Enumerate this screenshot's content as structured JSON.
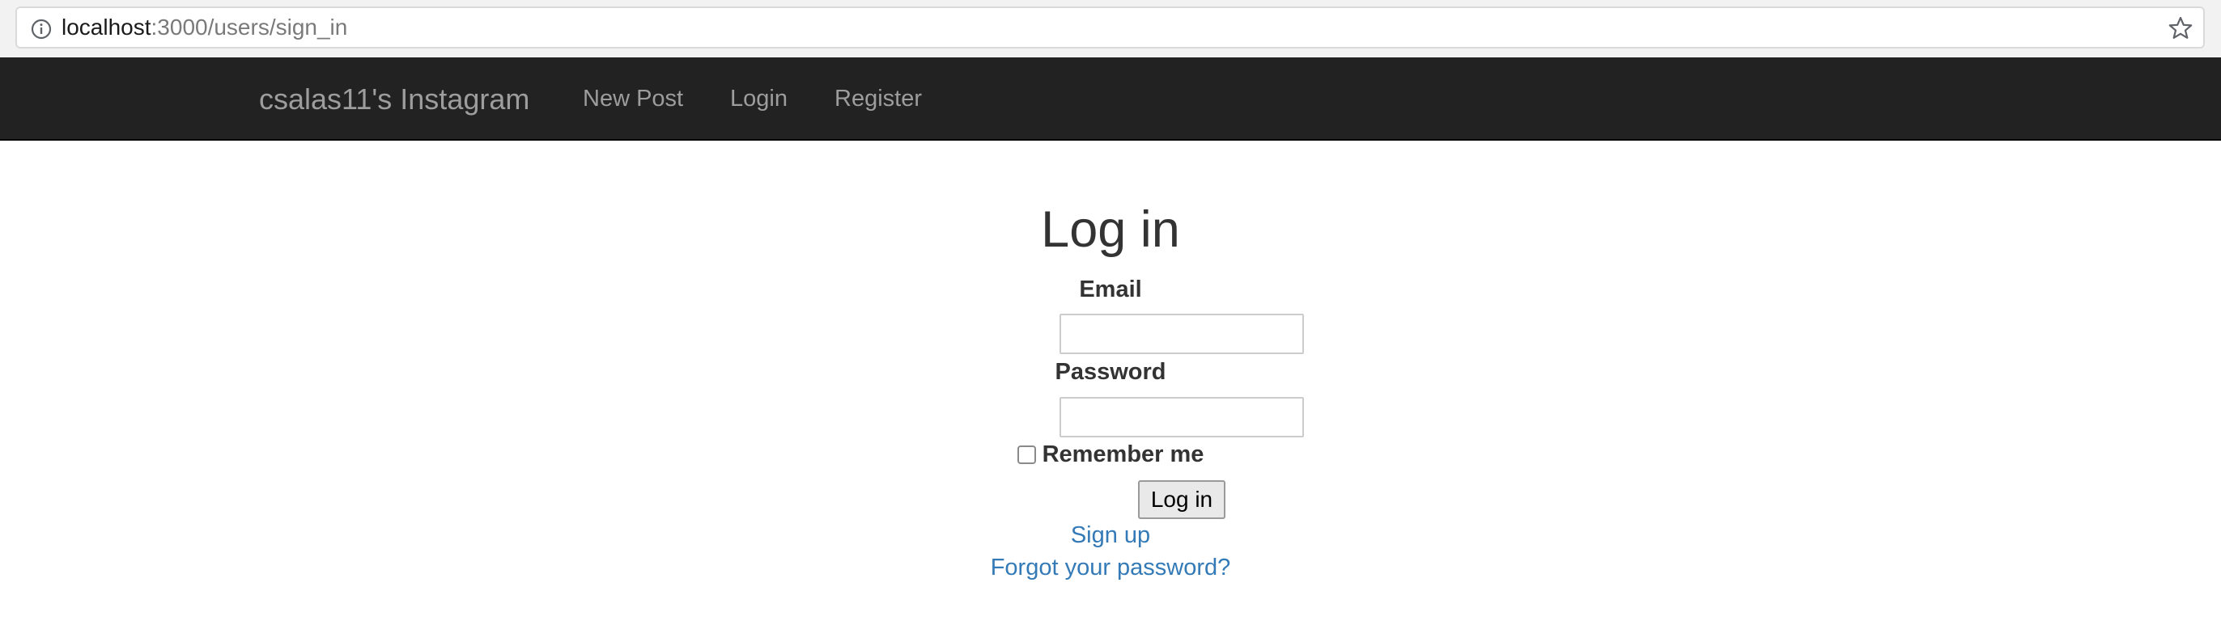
{
  "browser": {
    "url_host": "localhost",
    "url_path": ":3000/users/sign_in",
    "icons": {
      "info": "info-icon",
      "bookmark": "star-icon"
    }
  },
  "navbar": {
    "brand": "csalas11's Instagram",
    "links": [
      "New Post",
      "Login",
      "Register"
    ]
  },
  "form": {
    "title": "Log in",
    "email_label": "Email",
    "email_value": "",
    "password_label": "Password",
    "password_value": "",
    "remember_label": "Remember me",
    "remember_checked": false,
    "submit_label": "Log in",
    "signup_link": "Sign up",
    "forgot_link": "Forgot your password?"
  },
  "colors": {
    "navbar_bg": "#222222",
    "navbar_text": "#9d9d9d",
    "link": "#337ab7",
    "text": "#333333"
  }
}
